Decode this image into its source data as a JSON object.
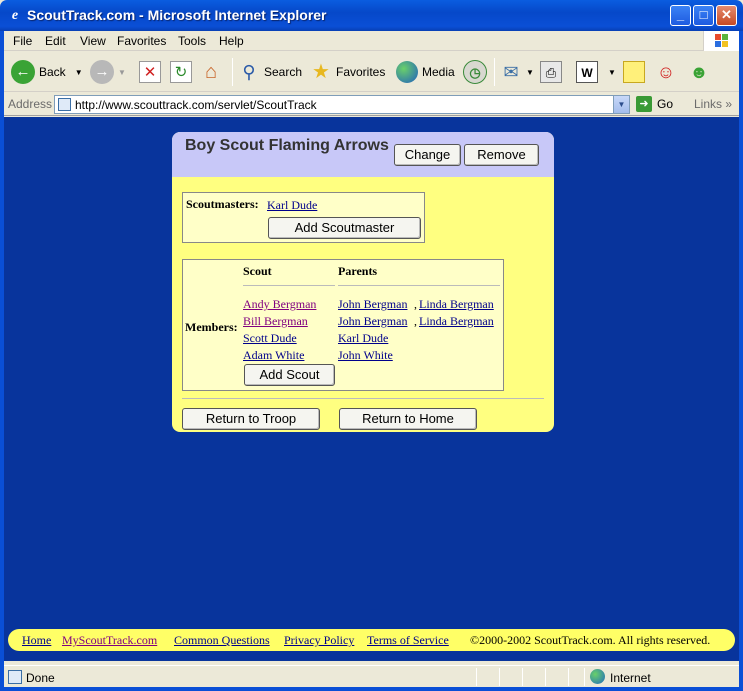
{
  "window": {
    "title": "ScoutTrack.com - Microsoft Internet Explorer"
  },
  "menubar": {
    "items": [
      "File",
      "Edit",
      "View",
      "Favorites",
      "Tools",
      "Help"
    ]
  },
  "toolbar": {
    "back": "Back",
    "search": "Search",
    "favorites": "Favorites",
    "media": "Media"
  },
  "address": {
    "label": "Address",
    "url": "http://www.scouttrack.com/servlet/ScoutTrack",
    "go": "Go",
    "links": "Links"
  },
  "troop": {
    "title": "Boy Scout Flaming Arrows",
    "change_label": "Change",
    "remove_label": "Remove",
    "scoutmasters_label": "Scoutmasters:",
    "scoutmasters": [
      "Karl Dude"
    ],
    "add_scoutmaster_label": "Add Scoutmaster",
    "members_label": "Members:",
    "columns": {
      "scout": "Scout",
      "parents": "Parents"
    },
    "members": [
      {
        "scout": "Andy Bergman",
        "parents": [
          "John Bergman",
          "Linda Bergman"
        ],
        "visited": true
      },
      {
        "scout": "Bill Bergman",
        "parents": [
          "John Bergman",
          "Linda Bergman"
        ],
        "visited": true
      },
      {
        "scout": "Scott Dude",
        "parents": [
          "Karl Dude"
        ],
        "visited": false
      },
      {
        "scout": "Adam White",
        "parents": [
          "John White"
        ],
        "visited": false
      }
    ],
    "add_scout_label": "Add Scout",
    "return_troop_label": "Return to Troop",
    "return_home_label": "Return to Home"
  },
  "footer": {
    "links": [
      "Home",
      "MyScoutTrack.com",
      "Common Questions",
      "Privacy Policy",
      "Terms of Service"
    ],
    "copyright": "©2000-2002 ScoutTrack.com. All rights reserved."
  },
  "status": {
    "text": "Done",
    "zone": "Internet"
  }
}
